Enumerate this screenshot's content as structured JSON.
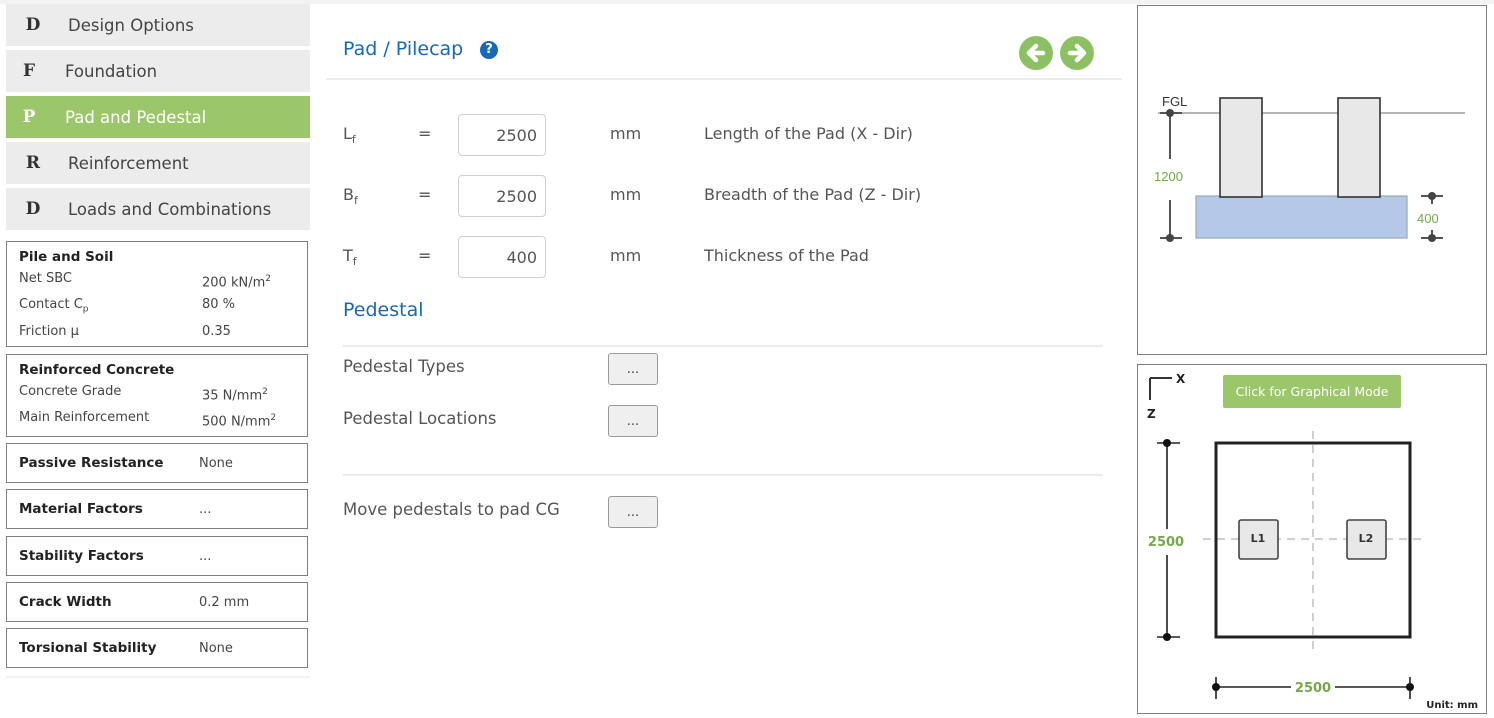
{
  "sidebar": {
    "nav": [
      {
        "letter": "D",
        "label": "Design Options",
        "active": false
      },
      {
        "letter": "F",
        "label": "Foundation",
        "active": false
      },
      {
        "letter": "P",
        "label": "Pad and Pedestal",
        "active": true
      },
      {
        "letter": "R",
        "label": "Reinforcement",
        "active": false
      },
      {
        "letter": "D",
        "label": "Loads and Combinations",
        "active": false
      }
    ],
    "pile_soil": {
      "title": "Pile and Soil",
      "net_sbc_label": "Net SBC",
      "net_sbc_value": "200 kN/m",
      "net_sbc_sup": "2",
      "contact_label": "Contact C",
      "contact_sub": "p",
      "contact_value": "80 %",
      "friction_label": "Friction μ",
      "friction_value": "0.35"
    },
    "concrete": {
      "title": "Reinforced Concrete",
      "grade_label": "Concrete Grade",
      "grade_value": "35 N/mm",
      "grade_sup": "2",
      "main_label": "Main Reinforcement",
      "main_value": "500 N/mm",
      "main_sup": "2"
    },
    "singles": [
      {
        "label": "Passive Resistance",
        "value": "None"
      },
      {
        "label": "Material Factors",
        "value": "..."
      },
      {
        "label": "Stability Factors",
        "value": "..."
      },
      {
        "label": "Crack Width",
        "value": "0.2 mm"
      },
      {
        "label": "Torsional Stability",
        "value": "None"
      }
    ]
  },
  "main": {
    "title": "Pad / Pilecap",
    "help_glyph": "?",
    "params": [
      {
        "sym": "L",
        "sub": "f",
        "eq": "=",
        "value": "2500",
        "unit": "mm",
        "desc": "Length of the Pad (X - Dir)"
      },
      {
        "sym": "B",
        "sub": "f",
        "eq": "=",
        "value": "2500",
        "unit": "mm",
        "desc": "Breadth of the Pad (Z - Dir)"
      },
      {
        "sym": "T",
        "sub": "f",
        "eq": "=",
        "value": "400",
        "unit": "mm",
        "desc": "Thickness of the Pad"
      }
    ],
    "pedestal": {
      "title": "Pedestal",
      "types_label": "Pedestal Types",
      "types_btn": "...",
      "locations_label": "Pedestal Locations",
      "locations_btn": "...",
      "move_label": "Move pedestals to pad CG",
      "move_btn": "..."
    }
  },
  "elevation": {
    "fgl_label": "FGL",
    "depth_value": "1200",
    "thickness_value": "400"
  },
  "plan": {
    "axis_x": "X",
    "axis_z": "Z",
    "graphical_btn": "Click for Graphical Mode",
    "breadth_value": "2500",
    "length_value": "2500",
    "pedestals": [
      "L1",
      "L2"
    ],
    "unit_label": "Unit: mm"
  },
  "colors": {
    "accent_green": "#9bc76a",
    "title_blue": "#1769b4",
    "pad_blue": "#b4c8e8",
    "dim_green": "#74a84a"
  }
}
